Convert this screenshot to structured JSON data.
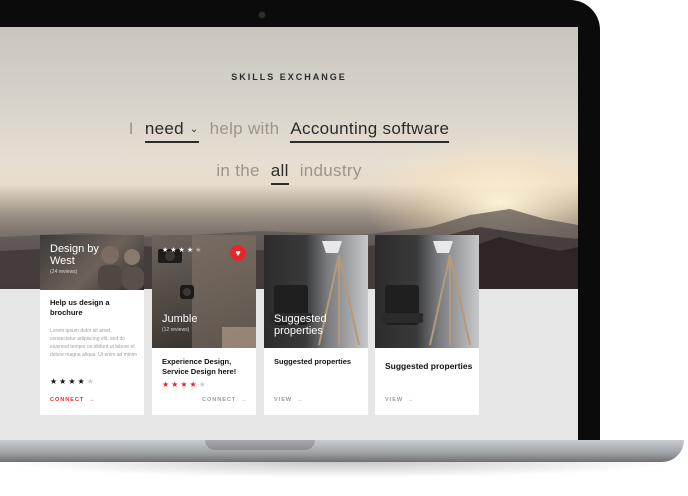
{
  "header": {
    "brand": "SKILLS EXCHANGE"
  },
  "search": {
    "word_i": "I",
    "need_select": "need",
    "word_help_with": "help with",
    "topic": "Accounting software",
    "word_in_the": "in the",
    "industry_select": "all",
    "word_industry": "industry"
  },
  "cards": [
    {
      "overlay_title": "Design by West",
      "reviews": "(24 reviews)",
      "heading": "Help us design a brochure",
      "body": "Lorem ipsum dolor sit amet, consectetur adipiscing elit, sed do eiusmod tempor incididunt ut labore et dolore magna aliqua. Ut enim ad minim",
      "rating": 4,
      "stars": "★★★★",
      "stars_empty": "★",
      "cta": "CONNECT",
      "cta_arrow": "→"
    },
    {
      "overlay_title": "Jumble",
      "reviews": "(12 reviews)",
      "top_stars": "★★★★",
      "top_stars_empty": "★",
      "heading": "Experience Design, Service Design here!",
      "rating": 4,
      "stars": "★★★★",
      "stars_empty": "★",
      "cta": "CONNECT",
      "cta_arrow": "→",
      "favorite_icon": "heart-icon"
    },
    {
      "overlay_title": "Suggested properties",
      "heading": "Suggested properties",
      "cta": "VIEW",
      "cta_arrow": "→"
    },
    {
      "heading": "Suggested properties",
      "cta": "VIEW",
      "cta_arrow": "→"
    }
  ],
  "colors": {
    "accent": "#e5262d",
    "text_dark": "#111111",
    "muted": "#9b958e"
  }
}
